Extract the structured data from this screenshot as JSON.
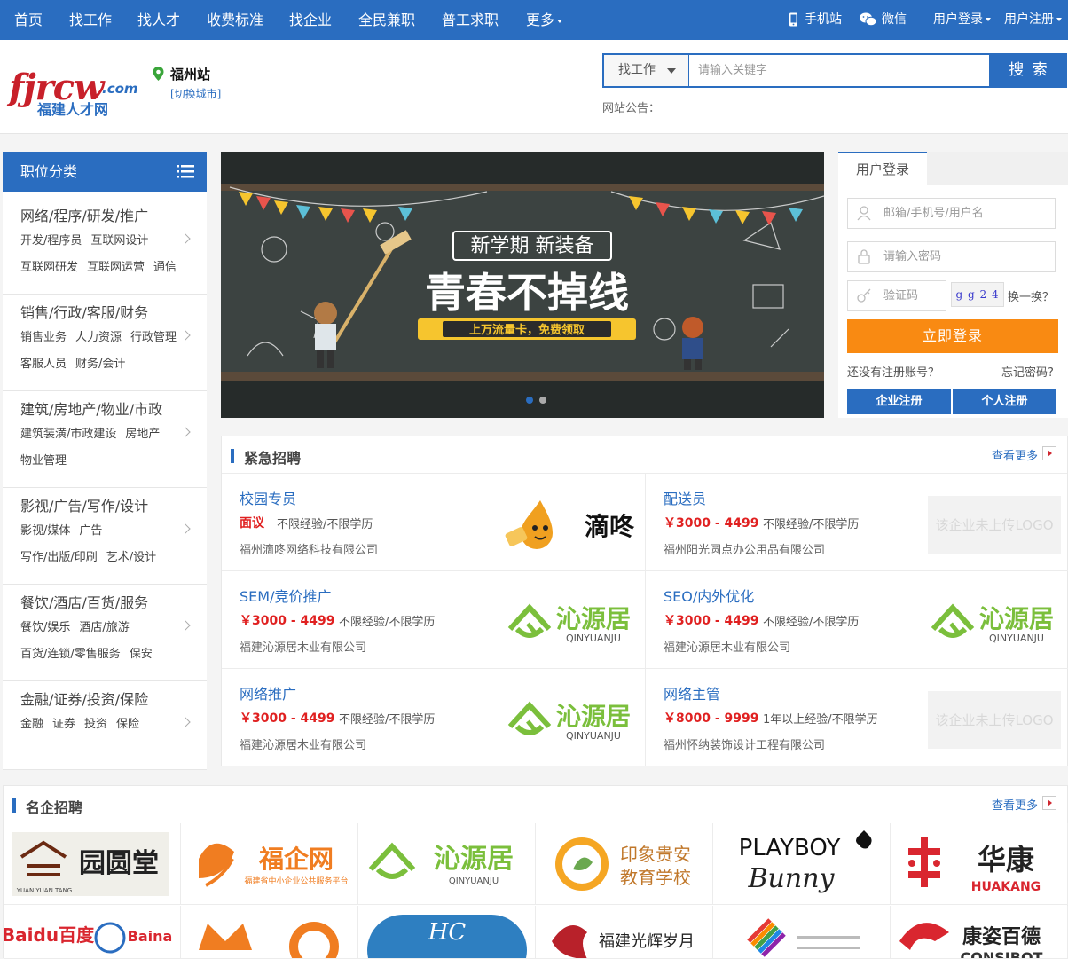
{
  "top_nav": {
    "items": [
      "首页",
      "找工作",
      "找人才",
      "收费标准",
      "找企业",
      "全民兼职",
      "普工求职",
      "更多"
    ],
    "right": {
      "mobile": "手机站",
      "wechat": "微信",
      "login": "用户登录",
      "register": "用户注册"
    }
  },
  "header": {
    "logo": {
      "main": "fjrcw",
      "com": ".com",
      "sub": "福建人才网"
    },
    "city": {
      "name": "福州站",
      "switch": "[切换城市]"
    },
    "search": {
      "type": "找工作",
      "placeholder": "请输入关键字",
      "button": "搜 索"
    },
    "notice": "网站公告："
  },
  "sidebar": {
    "title": "职位分类",
    "categories": [
      {
        "title": "网络/程序/研发/推广",
        "row1": [
          "开发/程序员",
          "互联网设计"
        ],
        "row2": [
          "互联网研发",
          "互联网运营",
          "通信"
        ]
      },
      {
        "title": "销售/行政/客服/财务",
        "row1": [
          "销售业务",
          "人力资源",
          "行政管理"
        ],
        "row2": [
          "客服人员",
          "财务/会计"
        ]
      },
      {
        "title": "建筑/房地产/物业/市政",
        "row1": [
          "建筑装潢/市政建设",
          "房地产"
        ],
        "row2": [
          "物业管理"
        ]
      },
      {
        "title": "影视/广告/写作/设计",
        "row1": [
          "影视/媒体",
          "广告"
        ],
        "row2": [
          "写作/出版/印刷",
          "艺术/设计"
        ]
      },
      {
        "title": "餐饮/酒店/百货/服务",
        "row1": [
          "餐饮/娱乐",
          "酒店/旅游"
        ],
        "row2": [
          "百货/连锁/零售服务",
          "保安"
        ]
      },
      {
        "title": "金融/证券/投资/保险",
        "row1": [
          "金融",
          "证券",
          "投资",
          "保险"
        ],
        "row2": []
      }
    ]
  },
  "banner": {
    "tag": "新学期 新装备",
    "headline": "青春不掉线",
    "ribbon": "上万流量卡，免费领取"
  },
  "login": {
    "tab": "用户登录",
    "username_placeholder": "邮箱/手机号/用户名",
    "password_placeholder": "请输入密码",
    "captcha_placeholder": "验证码",
    "captcha_text": "g g 2 4",
    "refresh": "换一换？",
    "submit": "立即登录",
    "no_account": "还没有注册账号？",
    "forgot": "忘记密码?",
    "company_register": "企业注册",
    "personal_register": "个人注册"
  },
  "urgent": {
    "title": "紧急招聘",
    "more": "查看更多",
    "jobs": [
      {
        "title": "校园专员",
        "salary": "面议",
        "req": "不限经验/不限学历",
        "company": "福州滴咚网络科技有限公司",
        "logo": "滴咚"
      },
      {
        "title": "配送员",
        "salary": "￥3000 - 4499",
        "req": "不限经验/不限学历",
        "company": "福州阳光圆点办公用品有限公司",
        "logo": "该企业未上传LOGO"
      },
      {
        "title": "SEM/竞价推广",
        "salary": "￥3000 - 4499",
        "req": "不限经验/不限学历",
        "company": "福建沁源居木业有限公司",
        "logo": "沁源居"
      },
      {
        "title": "SEO/内外优化",
        "salary": "￥3000 - 4499",
        "req": "不限经验/不限学历",
        "company": "福建沁源居木业有限公司",
        "logo": "沁源居"
      },
      {
        "title": "网络推广",
        "salary": "￥3000 - 4499",
        "req": "不限经验/不限学历",
        "company": "福建沁源居木业有限公司",
        "logo": "沁源居"
      },
      {
        "title": "网络主管",
        "salary": "￥8000 - 9999",
        "req": "1年以上经验/不限学历",
        "company": "福州怀纳装饰设计工程有限公司",
        "logo": "该企业未上传LOGO"
      }
    ]
  },
  "famous": {
    "title": "名企招聘",
    "more": "查看更多",
    "row1": [
      {
        "name": "园圆堂",
        "sub": "YUAN YUAN TANG"
      },
      {
        "name": "福企网",
        "sub": "福建省中小企业公共服务平台"
      },
      {
        "name": "沁源居",
        "sub": "QINYUANJU"
      },
      {
        "name": "印象贵安",
        "sub": "教育学校"
      },
      {
        "name": "PLAYBOY",
        "sub": "Bunny"
      },
      {
        "name": "华康",
        "sub": "HUAKANG"
      }
    ],
    "row2": [
      {
        "name": "Baidu百度",
        "sub": "Baina"
      },
      {
        "name": ""
      },
      {
        "name": "HC"
      },
      {
        "name": "福建光辉岁月"
      },
      {
        "name": ""
      },
      {
        "name": "康姿百德",
        "sub": "CONSIBOT"
      }
    ]
  },
  "colors": {
    "brand": "#2a6dc0",
    "accent": "#f98a12",
    "price": "#e02020",
    "logo_red": "#c8202a"
  }
}
